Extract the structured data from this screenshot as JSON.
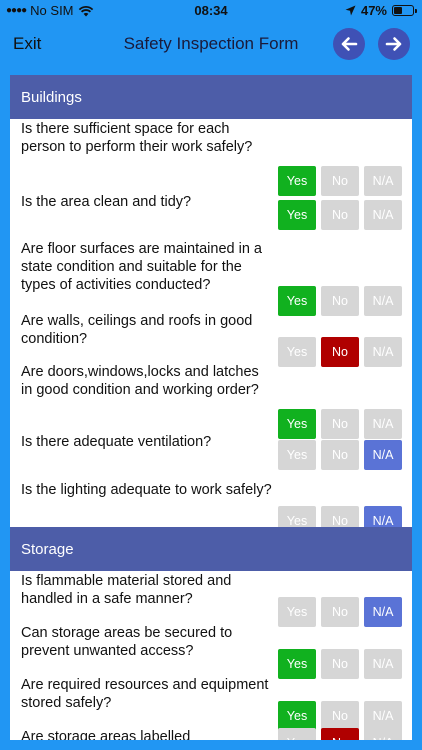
{
  "status": {
    "carrier": "No SIM",
    "time": "08:34",
    "battery": "47%",
    "battery_level": 0.47
  },
  "nav": {
    "exit_label": "Exit",
    "title": "Safety Inspection Form",
    "back_icon": "arrow-left-icon",
    "forward_icon": "arrow-right-icon"
  },
  "colors": {
    "header_bg": "#2196f3",
    "section_bg": "#4d5da8",
    "yes": "#11b11f",
    "no": "#b00000",
    "na": "#5a73d6",
    "inactive": "#d6d6d6"
  },
  "answer_labels": {
    "yes": "Yes",
    "no": "No",
    "na": "N/A"
  },
  "sections": [
    {
      "title": "Buildings",
      "questions": [
        {
          "text": "Is there sufficient space for each person to perform their work safely?",
          "answer": "yes"
        },
        {
          "text": "Is the area clean and tidy?",
          "answer": "yes"
        },
        {
          "text": "Are floor surfaces are maintained in a state condition and suitable for the types of activities conducted?",
          "answer": "yes"
        },
        {
          "text": "Are walls, ceilings and roofs in good condition?",
          "answer": "no"
        },
        {
          "text": "Are doors,windows,locks and latches in good condition and working order?",
          "answer": "yes"
        },
        {
          "text": "Is there adequate ventilation?",
          "answer": "na"
        },
        {
          "text": "Is the lighting adequate to work safely?",
          "answer": "na"
        }
      ]
    },
    {
      "title": "Storage",
      "questions": [
        {
          "text": "Is flammable material stored and handled in a safe manner?",
          "answer": "na"
        },
        {
          "text": "Can storage areas be secured to prevent unwanted access?",
          "answer": "yes"
        },
        {
          "text": "Are required resources and equipment stored safely?",
          "answer": "yes"
        },
        {
          "text": "Are storage areas labelled",
          "answer": "no"
        }
      ]
    }
  ]
}
